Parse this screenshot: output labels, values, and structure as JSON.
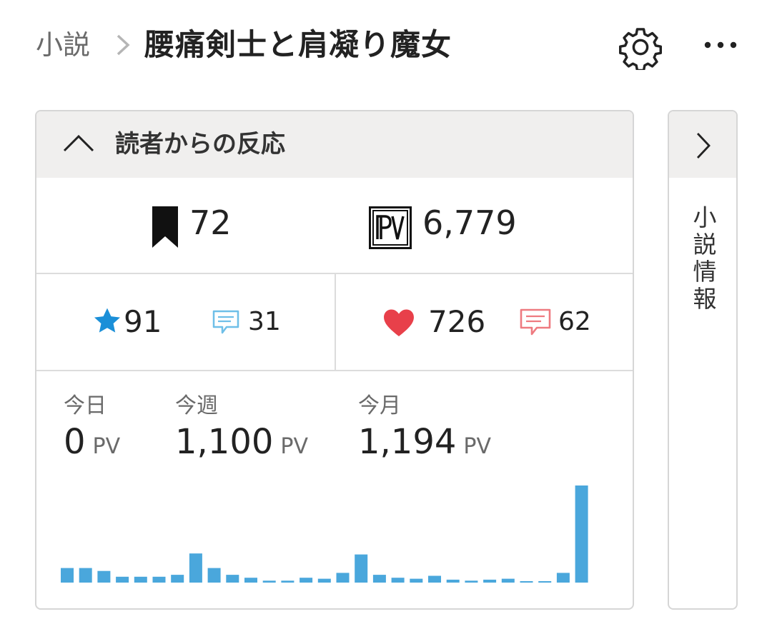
{
  "header": {
    "breadcrumb": "小説",
    "title": "腰痛剣士と肩凝り魔女"
  },
  "card": {
    "section_title": "読者からの反応",
    "bookmarks": "72",
    "pv_total": "6,779",
    "stars": "91",
    "star_comments": "31",
    "hearts": "726",
    "heart_comments": "62",
    "stats": {
      "today_label": "今日",
      "today_value": "0",
      "week_label": "今週",
      "week_value": "1,100",
      "month_label": "今月",
      "month_value": "1,194",
      "unit": "PV"
    }
  },
  "side_panel": {
    "label_chars": [
      "小",
      "説",
      "情",
      "報"
    ]
  },
  "colors": {
    "accent_blue": "#1a8fd8",
    "heart_red": "#e8404a",
    "bar_blue": "#4aa7dc",
    "comment_blue": "#6fbfe8",
    "comment_red": "#ee7a80"
  },
  "chart_data": {
    "type": "bar",
    "values": [
      15,
      15,
      12,
      6,
      6,
      6,
      8,
      30,
      15,
      8,
      5,
      2,
      2,
      5,
      4,
      10,
      29,
      8,
      5,
      4,
      7,
      3,
      2,
      3,
      4,
      1,
      1,
      10,
      100
    ]
  }
}
